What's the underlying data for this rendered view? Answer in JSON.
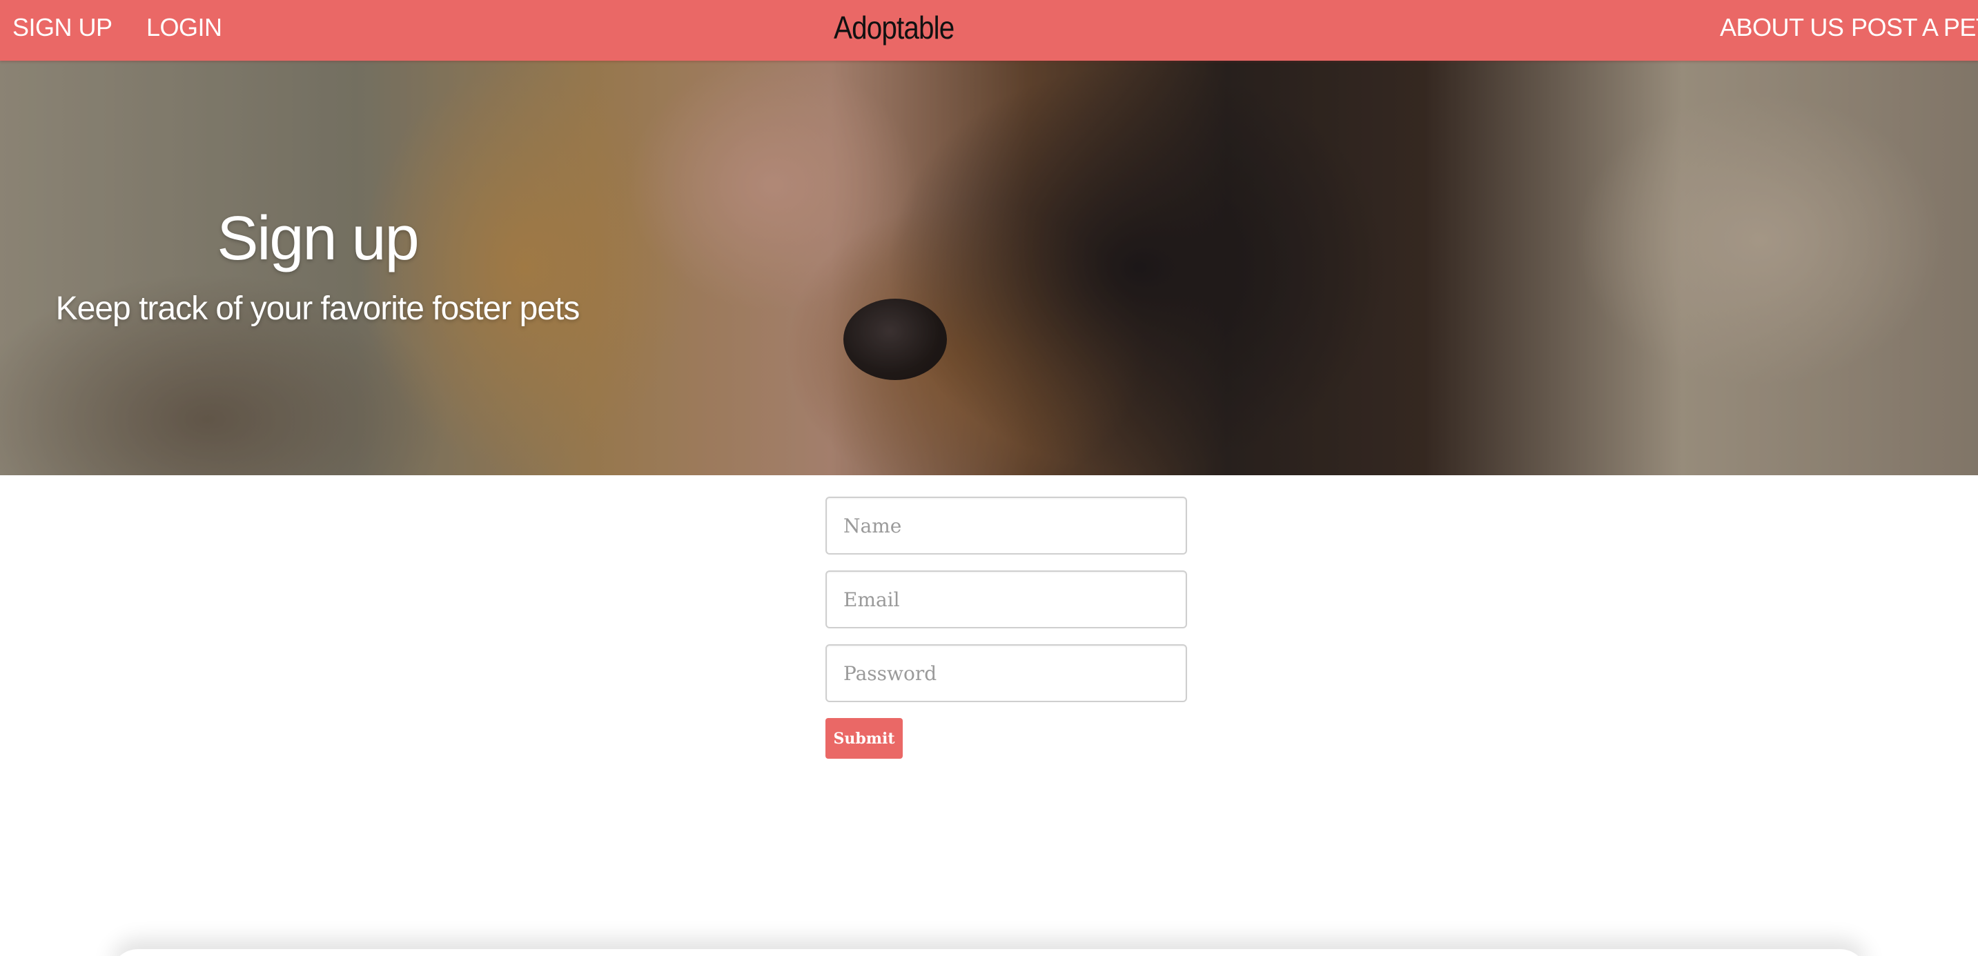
{
  "nav": {
    "signup_label": "SIGN UP",
    "login_label": "LOGIN",
    "brand": "Adoptable",
    "about_label": "ABOUT US",
    "post_label": "POST A PET"
  },
  "hero": {
    "title": "Sign up",
    "subtitle": "Keep track of your favorite foster pets"
  },
  "form": {
    "name_placeholder": "Name",
    "email_placeholder": "Email",
    "password_placeholder": "Password",
    "submit_label": "Submit"
  },
  "colors": {
    "accent": "#ea6866",
    "brand_text": "#111111"
  }
}
